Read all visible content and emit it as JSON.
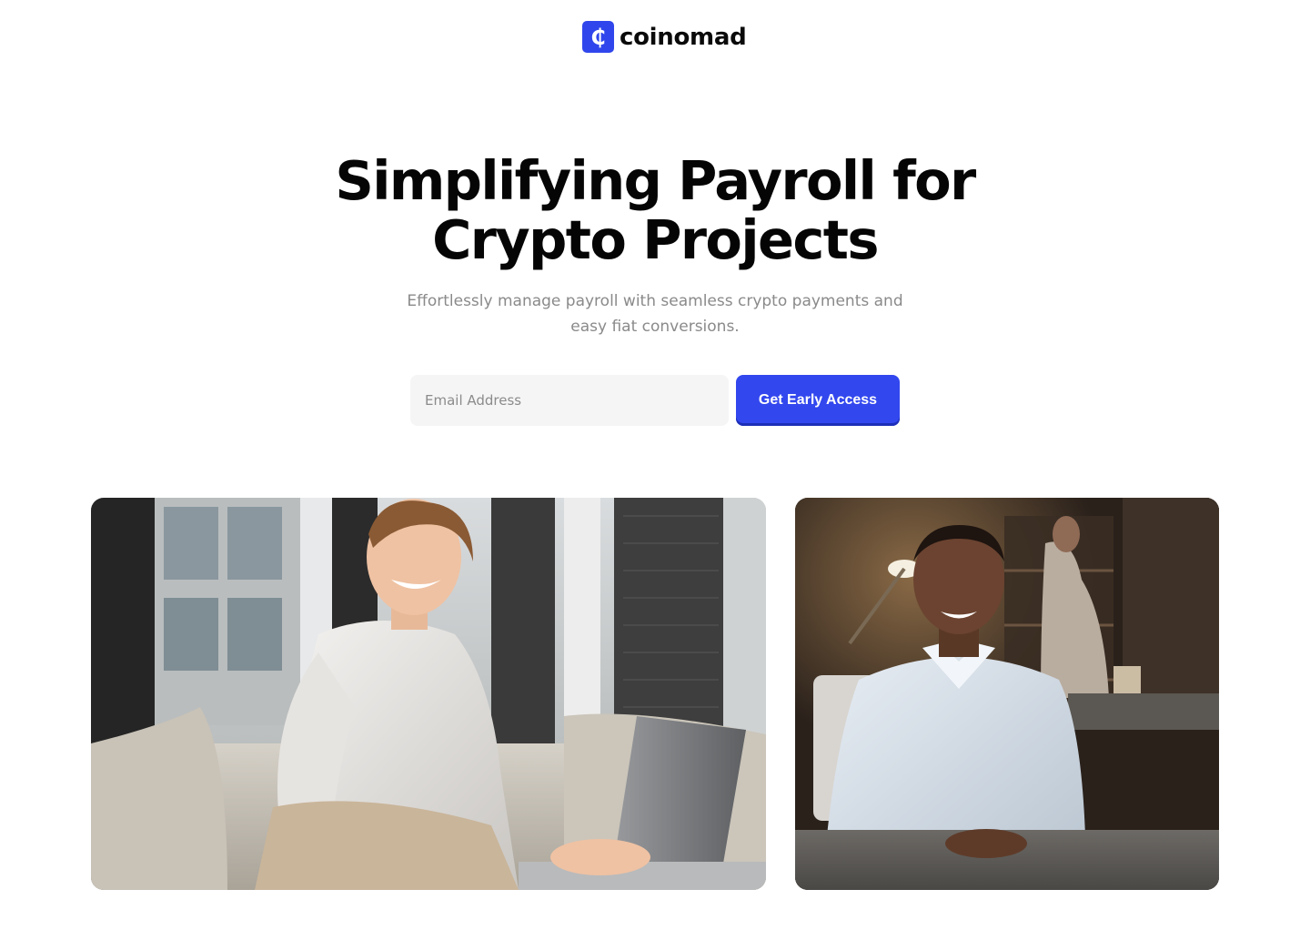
{
  "brand": {
    "logo_glyph": "₵",
    "name": "coinomad",
    "accent_color": "#3247ee"
  },
  "hero": {
    "title_line1": "Simplifying Payroll for",
    "title_line2": "Crypto Projects",
    "subtitle_line1": "Effortlessly manage payroll with seamless crypto payments and",
    "subtitle_line2": "easy fiat conversions."
  },
  "signup": {
    "email_placeholder": "Email Address",
    "email_value": "",
    "cta_label": "Get Early Access"
  },
  "images": [
    {
      "name": "smiling-man-with-laptop-photo"
    },
    {
      "name": "smiling-man-at-desk-photo"
    }
  ]
}
